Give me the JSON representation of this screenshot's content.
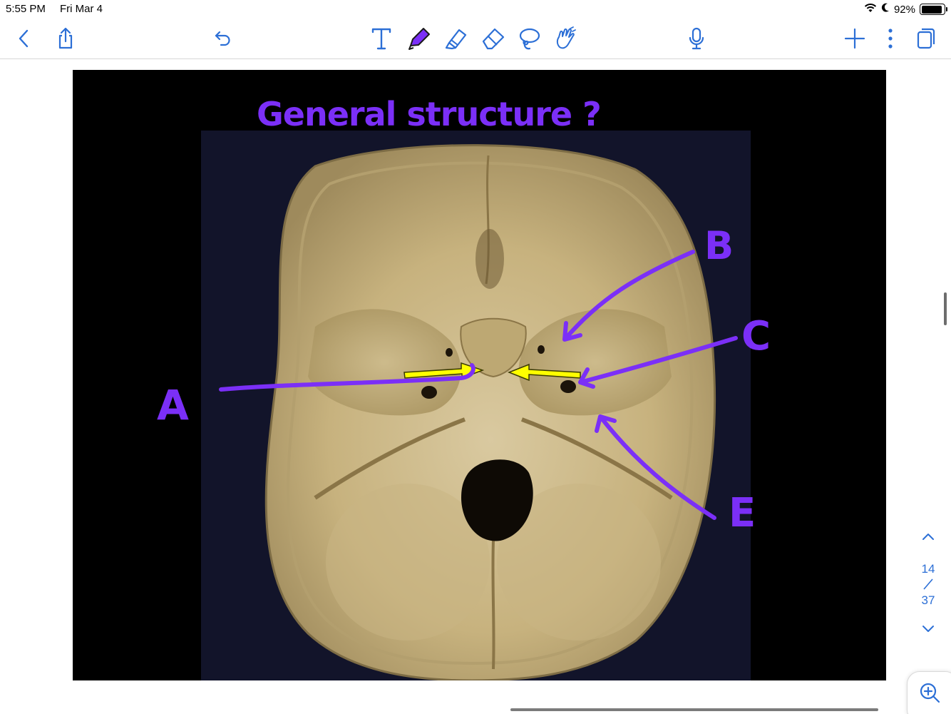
{
  "status_bar": {
    "time": "5:55 PM",
    "date": "Fri Mar 4",
    "battery_text": "92%",
    "battery_level": 0.92
  },
  "toolbar": {
    "left": [
      "back-icon",
      "share-icon",
      "undo-icon"
    ],
    "tools": [
      "text-tool-icon",
      "pen-tool-icon",
      "highlighter-tool-icon",
      "eraser-tool-icon",
      "lasso-tool-icon",
      "shapes-tool-icon"
    ],
    "active_tool": "pen-tool-icon",
    "right": [
      "microphone-icon",
      "add-page-icon",
      "more-icon",
      "pages-icon"
    ],
    "pen_color": "#7b2ff7",
    "accent_color": "#2c6fd6"
  },
  "slide": {
    "annotation_title": "General structure ?",
    "labels": {
      "A": "A",
      "B": "B",
      "C": "C",
      "E": "E"
    },
    "pointer_color": "#ffff00"
  },
  "page_nav": {
    "current": "14",
    "total": "37"
  }
}
